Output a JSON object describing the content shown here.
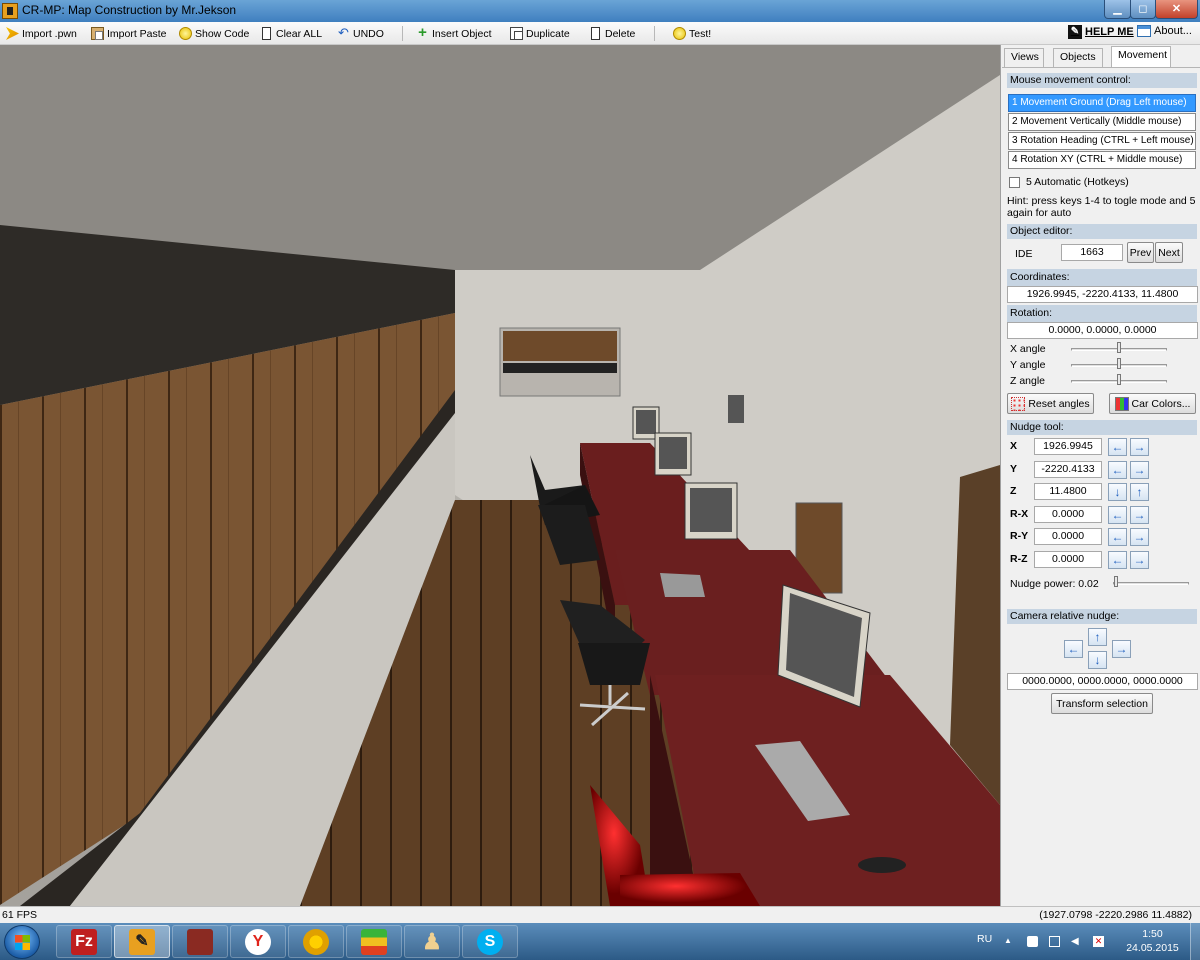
{
  "window": {
    "title": "CR-MP: Map Construction by Mr.Jekson",
    "minimize_glyph": "▁",
    "maximize_glyph": "◻",
    "close_glyph": "✕"
  },
  "toolbar": {
    "import_pwn": "Import .pwn",
    "import_paste": "Import Paste",
    "show_code": "Show Code",
    "clear_all": "Clear ALL",
    "undo": "UNDO",
    "insert_object": "Insert Object",
    "duplicate": "Duplicate",
    "delete": "Delete",
    "test": "Test!",
    "help": "HELP ME",
    "about": "About..."
  },
  "tabs": [
    "Views",
    "Objects",
    "Movement"
  ],
  "active_tab": "Movement",
  "mouse_control": {
    "heading": "Mouse movement control:",
    "modes": [
      "1 Movement Ground (Drag Left mouse)",
      "2 Movement Vertically (Middle mouse)",
      "3 Rotation Heading (CTRL + Left mouse)",
      "4 Rotation XY (CTRL + Middle mouse)"
    ],
    "selected_mode": "1 Movement Ground (Drag Left mouse)",
    "automatic_label": "5 Automatic (Hotkeys)",
    "automatic_checked": false,
    "hint": "Hint: press keys 1-4 to togle mode and 5 again for auto"
  },
  "object_editor": {
    "heading": "Object editor:",
    "ide_label": "IDE",
    "ide_value": "1663",
    "prev": "Prev",
    "next": "Next",
    "coordinates_label": "Coordinates:",
    "coordinates_value": "1926.9945, -2220.4133, 11.4800",
    "rotation_label": "Rotation:",
    "rotation_value": "0.0000, 0.0000, 0.0000",
    "x_angle": "X angle",
    "y_angle": "Y angle",
    "z_angle": "Z angle",
    "angle_slider_levels": [
      0.5,
      0.5,
      0.5
    ],
    "reset_angles": "Reset angles",
    "car_colors": "Car Colors..."
  },
  "nudge": {
    "heading": "Nudge tool:",
    "rows": [
      {
        "label": "X",
        "value": "1926.9945",
        "arrows": [
          "←",
          "→"
        ]
      },
      {
        "label": "Y",
        "value": "-2220.4133",
        "arrows": [
          "←",
          "→"
        ]
      },
      {
        "label": "Z",
        "value": "11.4800",
        "arrows": [
          "↓",
          "↑"
        ]
      },
      {
        "label": "R-X",
        "value": "0.0000",
        "arrows": [
          "←",
          "→"
        ]
      },
      {
        "label": "R-Y",
        "value": "0.0000",
        "arrows": [
          "←",
          "→"
        ]
      },
      {
        "label": "R-Z",
        "value": "0.0000",
        "arrows": [
          "←",
          "→"
        ]
      }
    ],
    "power_label": "Nudge power: 0.02",
    "power_level": 0.02
  },
  "camera_nudge": {
    "heading": "Camera relative nudge:",
    "arrows": {
      "up": "↑",
      "down": "↓",
      "left": "←",
      "right": "→"
    },
    "value": "0000.0000, 0000.0000, 0000.0000",
    "transform": "Transform selection"
  },
  "status": {
    "fps": "61 FPS",
    "coords": "(1927.0798 -2220.2986 11.4882)"
  },
  "taskbar": {
    "apps": [
      "start-button",
      "filezilla",
      "cr-mp-map-construction",
      "game",
      "yandex-browser",
      "chrome",
      "bluestacks",
      "chess",
      "skype"
    ],
    "filezilla_letter": "Fz",
    "yandex_letter": "Y",
    "skype_letter": "S",
    "language": "RU",
    "time": "1:50",
    "date": "24.05.2015"
  },
  "colors": {
    "title_bar": "#3f7fbf",
    "selection": "#3399ff",
    "section_header": "#c6d4e2",
    "panel_bg": "#f0f0f0"
  }
}
